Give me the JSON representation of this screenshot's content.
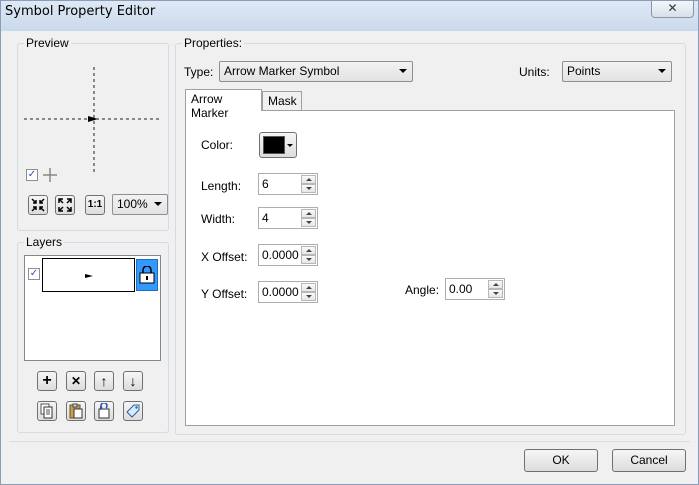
{
  "window": {
    "title": "Symbol Property Editor",
    "close_label": "✕"
  },
  "preview": {
    "label": "Preview",
    "show_cross_checked": "✓",
    "zoom_value": "100%",
    "one_to_one_label": "1:1"
  },
  "layers": {
    "label": "Layers",
    "checked": "✓",
    "buttons": {
      "add": "+",
      "remove": "✕",
      "up": "↑",
      "down": "↓"
    }
  },
  "properties": {
    "label": "Properties:",
    "type_label": "Type:",
    "type_value": "Arrow Marker Symbol",
    "units_label": "Units:",
    "units_value": "Points",
    "tabs": [
      {
        "label": "Arrow Marker"
      },
      {
        "label": "Mask"
      }
    ],
    "fields": {
      "color_label": "Color:",
      "length_label": "Length:",
      "length_value": "6",
      "width_label": "Width:",
      "width_value": "4",
      "x_offset_label": "X Offset:",
      "x_offset_value": "0.0000",
      "y_offset_label": "Y Offset:",
      "y_offset_value": "0.0000",
      "angle_label": "Angle:",
      "angle_value": "0.00"
    },
    "color_value": "#000000"
  },
  "footer": {
    "ok_label": "OK",
    "cancel_label": "Cancel"
  }
}
